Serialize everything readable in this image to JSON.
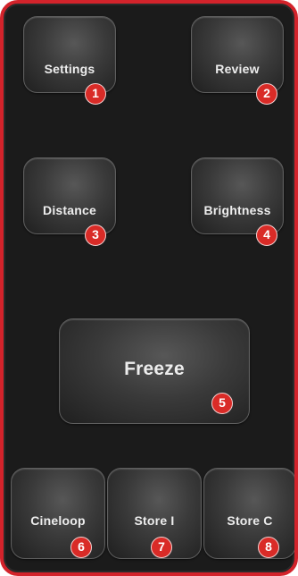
{
  "colors": {
    "panel_background": "#1b1b1b",
    "panel_border": "#d3232b",
    "button_face": "#3a3a3a",
    "button_text": "#ededed",
    "badge_background": "#d92b27",
    "badge_text": "#ffffff"
  },
  "buttons": [
    {
      "id": "settings",
      "label": "Settings",
      "badge": "1"
    },
    {
      "id": "review",
      "label": "Review",
      "badge": "2"
    },
    {
      "id": "distance",
      "label": "Distance",
      "badge": "3"
    },
    {
      "id": "brightness",
      "label": "Brightness",
      "badge": "4"
    },
    {
      "id": "freeze",
      "label": "Freeze",
      "badge": "5"
    },
    {
      "id": "cineloop",
      "label": "Cineloop",
      "badge": "6"
    },
    {
      "id": "store_i",
      "label": "Store I",
      "badge": "7"
    },
    {
      "id": "store_c",
      "label": "Store C",
      "badge": "8"
    }
  ]
}
